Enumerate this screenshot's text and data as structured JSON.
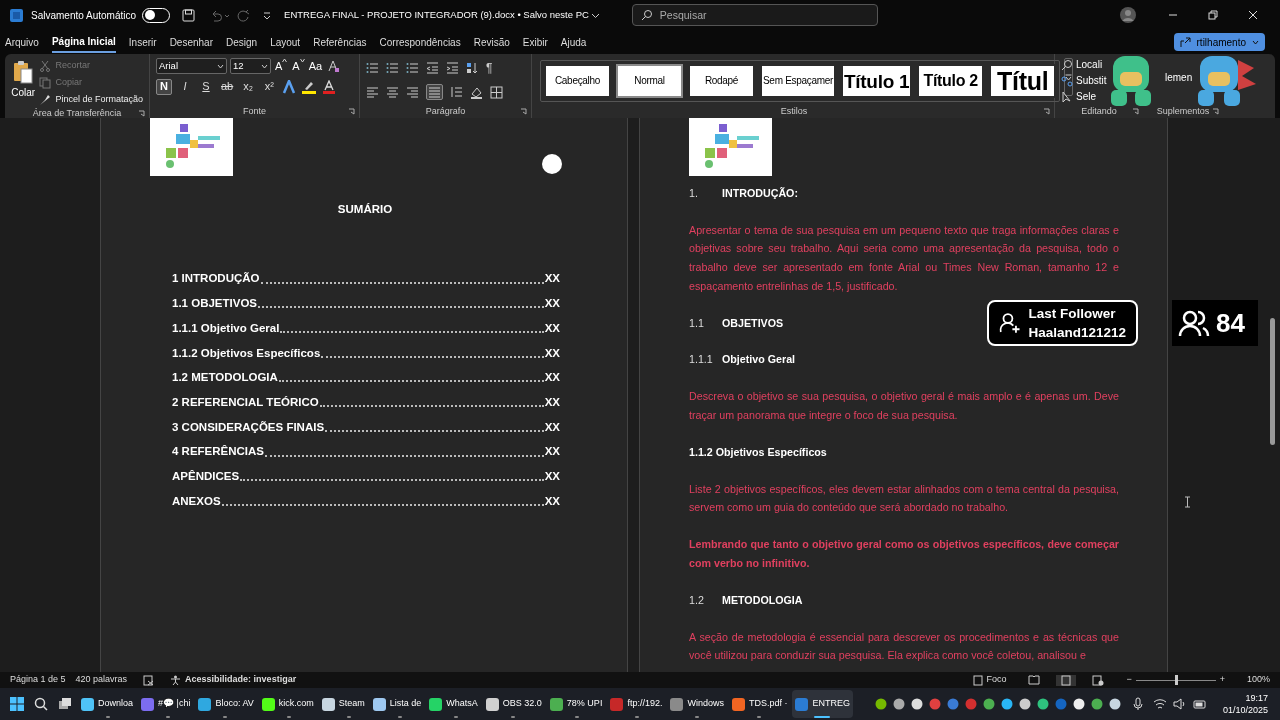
{
  "title_bar": {
    "autosave_label": "Salvamento Automático",
    "autosave_on": false,
    "document_title": "ENTREGA FINAL - PROJETO INTEGRADOR (9).docx • Salvo neste PC",
    "search_placeholder": "Pesquisar"
  },
  "ribbon_tabs": [
    {
      "label": "Arquivo",
      "selected": false
    },
    {
      "label": "Página Inicial",
      "selected": true
    },
    {
      "label": "Inserir",
      "selected": false
    },
    {
      "label": "Desenhar",
      "selected": false
    },
    {
      "label": "Design",
      "selected": false
    },
    {
      "label": "Layout",
      "selected": false
    },
    {
      "label": "Referências",
      "selected": false
    },
    {
      "label": "Correspondências",
      "selected": false
    },
    {
      "label": "Revisão",
      "selected": false
    },
    {
      "label": "Exibir",
      "selected": false
    },
    {
      "label": "Ajuda",
      "selected": false
    }
  ],
  "share_button": {
    "label": "rtilhamento"
  },
  "clipboard": {
    "paste": "Colar",
    "group_label": "Área de Transferência",
    "items": [
      {
        "label": "Recortar",
        "disabled": true
      },
      {
        "label": "Copiar",
        "disabled": true
      },
      {
        "label": "Pincel de Formatação",
        "disabled": false
      }
    ]
  },
  "font": {
    "family": "Arial",
    "size": "12",
    "size_buttons": [
      "A",
      "A"
    ],
    "case_button": "Aa",
    "group_label": "Fonte",
    "format_buttons": [
      {
        "label": "N",
        "kind": "bold",
        "selected": true
      },
      {
        "label": "I",
        "kind": "italic",
        "selected": false
      },
      {
        "label": "S",
        "kind": "underline",
        "selected": false
      },
      {
        "label": "ab",
        "kind": "strike",
        "selected": false
      },
      {
        "label": "x₂",
        "kind": "sub",
        "selected": false
      },
      {
        "label": "x²",
        "kind": "sup",
        "selected": false
      }
    ]
  },
  "paragraph": {
    "group_label": "Parágrafo",
    "pilcrow": "¶"
  },
  "styles": {
    "group_label": "Estilos",
    "items": [
      {
        "label": "Cabeçalho",
        "kind": "plain",
        "selected": false
      },
      {
        "label": "Normal",
        "kind": "plain",
        "selected": true
      },
      {
        "label": "Rodapé",
        "kind": "plain",
        "selected": false
      },
      {
        "label": "Sem Espaçamer",
        "kind": "plain",
        "selected": false
      },
      {
        "label": "Título 1",
        "kind": "title1",
        "selected": false
      },
      {
        "label": "Título 2",
        "kind": "title2",
        "selected": false
      },
      {
        "label": "Títul",
        "kind": "title",
        "selected": false
      }
    ]
  },
  "editing": {
    "group_label": "Editando",
    "items": [
      "Locali",
      "Substit",
      "Sele"
    ]
  },
  "addins": {
    "group_label": "Suplementos",
    "item": "lemen"
  },
  "toc": {
    "title": "SUMÁRIO",
    "entries": [
      {
        "label": "1 INTRODUÇÃO",
        "page": "XX"
      },
      {
        "label": "1.1 OBJETIVOS",
        "page": "XX"
      },
      {
        "label": "1.1.1 Objetivo Geral",
        "page": "XX"
      },
      {
        "label": "1.1.2 Objetivos Específicos",
        "page": "XX"
      },
      {
        "label": "1.2 METODOLOGIA",
        "page": "XX"
      },
      {
        "label": "2 REFERENCIAL TEÓRICO",
        "page": "XX"
      },
      {
        "label": "3 CONSIDERAÇÕES FINAIS",
        "page": "XX"
      },
      {
        "label": "4 REFERÊNCIAS",
        "page": "XX"
      },
      {
        "label": "APÊNDICES",
        "page": "XX"
      },
      {
        "label": "ANEXOS",
        "page": "XX"
      }
    ]
  },
  "body": [
    {
      "kind": "heading",
      "number": "1.",
      "text": "INTRODUÇÃO:"
    },
    {
      "kind": "para",
      "text": "Apresentar o tema de sua pesquisa em um pequeno texto que traga informações claras e objetivas sobre seu trabalho. Aqui seria como uma apresentação da pesquisa, todo o trabalho deve ser apresentado em fonte Arial ou Times New Roman, tamanho 12 e espaçamento entrelinhas de 1,5, justificado."
    },
    {
      "kind": "heading",
      "number": "1.1",
      "text": "OBJETIVOS"
    },
    {
      "kind": "heading",
      "number": "1.1.1",
      "text": "Objetivo Geral"
    },
    {
      "kind": "para",
      "text": "Descreva o objetivo se sua pesquisa, o objetivo geral é mais amplo e é apenas um. Deve traçar um panorama que integre o foco de sua pesquisa."
    },
    {
      "kind": "subheading",
      "text": "1.1.2 Objetivos Específicos"
    },
    {
      "kind": "para",
      "text": "Liste 2 objetivos específicos, eles devem estar alinhados com o tema central da pesquisa, servem como um guia do conteúdo que será abordado no trabalho."
    },
    {
      "kind": "bold_para",
      "text": "Lembrando que tanto o objetivo geral como os objetivos específicos, deve começar com verbo no infinitivo."
    },
    {
      "kind": "heading",
      "number": "1.2",
      "text": "METODOLOGIA"
    },
    {
      "kind": "para",
      "text": "A seção de metodologia é essencial para descrever os procedimentos e as técnicas que você utilizou para conduzir sua pesquisa. Ela explica como você coletou, analisou e"
    }
  ],
  "follower_alert": {
    "title": "Last Follower",
    "name": "Haaland121212"
  },
  "follower_count": "84",
  "status_bar": {
    "page": "Página 1 de 5",
    "words": "420 palavras",
    "accessibility": "Acessibilidade: investigar",
    "focus": "Foco",
    "zoom_out": "−",
    "level": 0.5,
    "zoom_in": "+",
    "zoom": "100%"
  },
  "taskbar": {
    "apps": [
      {
        "label": "Downloa",
        "color": "#4fc3f7",
        "selected": false
      },
      {
        "label": "#💬 |chi",
        "color": "#7c6cf0",
        "selected": false
      },
      {
        "label": "Bloco: AV",
        "color": "#2fa8e0",
        "selected": false
      },
      {
        "label": "kick.com",
        "color": "#53fc18",
        "selected": false
      },
      {
        "label": "Steam",
        "color": "#c7d5e0",
        "selected": false
      },
      {
        "label": "Lista de",
        "color": "#9ec8f0",
        "selected": false
      },
      {
        "label": "WhatsA",
        "color": "#25d366",
        "selected": false
      },
      {
        "label": "OBS 32.0",
        "color": "#d0d0d0",
        "selected": false
      },
      {
        "label": "78% UPI",
        "color": "#4caf50",
        "selected": false
      },
      {
        "label": "ftp://192.",
        "color": "#c62828",
        "selected": false
      },
      {
        "label": "Windows",
        "color": "#8a8a8a",
        "selected": false
      },
      {
        "label": "TDS.pdf ·",
        "color": "#f26522",
        "selected": false
      },
      {
        "label": "ENTREG",
        "color": "#2b7cd3",
        "selected": true
      }
    ],
    "time": "19:17",
    "date": "01/10/2025"
  }
}
